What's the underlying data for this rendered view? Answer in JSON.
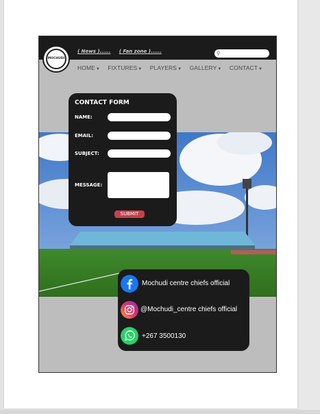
{
  "header": {
    "logo_text": "MOCHUDI",
    "links": [
      "( News )......",
      "( Fan zone )......"
    ]
  },
  "nav": {
    "items": [
      {
        "label": "HOME"
      },
      {
        "label": "FIXTURES"
      },
      {
        "label": "PLAYERS"
      },
      {
        "label": "GALLERY"
      },
      {
        "label": "CONTACT"
      }
    ]
  },
  "contact_form": {
    "title": "CONTACT FORM",
    "name_label": "NAME:",
    "email_label": "EMAIL:",
    "subject_label": "SUBJECT:",
    "message_label": "MESSAGE:",
    "submit_label": "SUBMIT"
  },
  "social": {
    "facebook": "Mochudi centre chiefs official",
    "instagram": "@Mochudi_centre chiefs official",
    "whatsapp": "+267 3500130"
  },
  "colors": {
    "header_bg": "#1b1b1b",
    "panel_bg": "#1b1b1b",
    "submit_bg": "#c4414c",
    "facebook": "#1877f2",
    "whatsapp": "#25d366"
  }
}
